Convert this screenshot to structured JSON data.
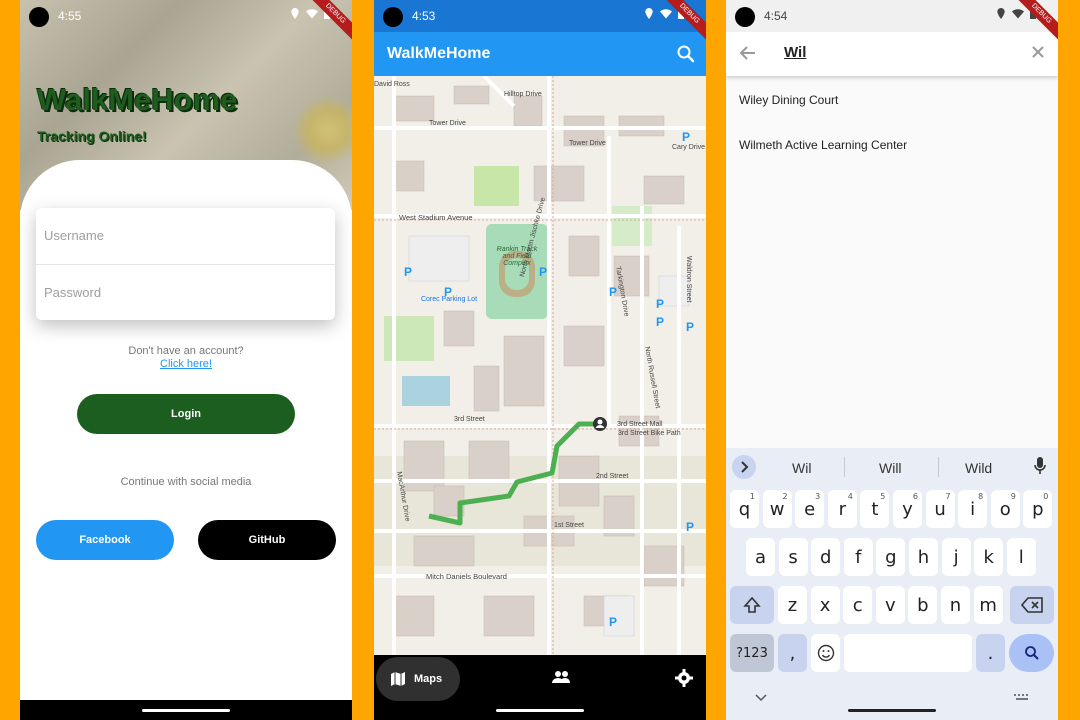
{
  "phone_login": {
    "status_time": "4:55",
    "debug_label": "DEBUG",
    "app_title": "WalkMeHome",
    "subtitle": "Tracking Online!",
    "username_placeholder": "Username",
    "password_placeholder": "Password",
    "no_account_text": "Don't have an account?",
    "signup_link": "Click here!",
    "login_label": "Login",
    "social_text": "Continue with social media",
    "facebook_label": "Facebook",
    "github_label": "GitHub",
    "colors": {
      "primary_green": "#1b5e20",
      "facebook_blue": "#2196F3",
      "github_black": "#000000"
    }
  },
  "phone_map": {
    "status_time": "4:53",
    "debug_label": "DEBUG",
    "app_title": "WalkMeHome",
    "map_labels": {
      "hilltop_drive": "Hilltop Drive",
      "tower_drive": "Tower Drive",
      "tower_drive_2": "Tower Drive",
      "cary_drive": "Cary Drive",
      "west_stadium": "West Stadium Avenue",
      "rankin": "Rankin Track and Field Complex",
      "corec": "Corec Parking Lot",
      "third_street": "3rd Street",
      "third_mall": "3rd Street Mall",
      "third_bike": "3rd Street Bike Path",
      "second_street": "2nd Street",
      "first_street": "1st Street",
      "mitch_daniels": "Mitch Daniels Boulevard",
      "jischke": "North Martin Jischke Drive",
      "russell": "North Russell Street",
      "waldron": "Waldron Street",
      "macarthur": "MacArthur Drive",
      "tarkington": "Tarkington Drive",
      "david_ross": "David Ross"
    },
    "nav": {
      "maps_label": "Maps"
    },
    "colors": {
      "appbar": "#2196F3",
      "route": "#4caf50"
    }
  },
  "phone_search": {
    "status_time": "4:54",
    "debug_label": "DEBUG",
    "query": "Wil",
    "results": [
      "Wiley Dining Court",
      "Wilmeth Active Learning Center"
    ],
    "suggestions": [
      "Wil",
      "Will",
      "Wild"
    ],
    "keyboard": {
      "row1": [
        [
          "q",
          "1"
        ],
        [
          "w",
          "2"
        ],
        [
          "e",
          "3"
        ],
        [
          "r",
          "4"
        ],
        [
          "t",
          "5"
        ],
        [
          "y",
          "6"
        ],
        [
          "u",
          "7"
        ],
        [
          "i",
          "8"
        ],
        [
          "o",
          "9"
        ],
        [
          "p",
          "0"
        ]
      ],
      "row2": [
        "a",
        "s",
        "d",
        "f",
        "g",
        "h",
        "j",
        "k",
        "l"
      ],
      "row3": [
        "z",
        "x",
        "c",
        "v",
        "b",
        "n",
        "m"
      ],
      "symbols_key": "?123",
      "comma": ",",
      "period": "."
    }
  }
}
